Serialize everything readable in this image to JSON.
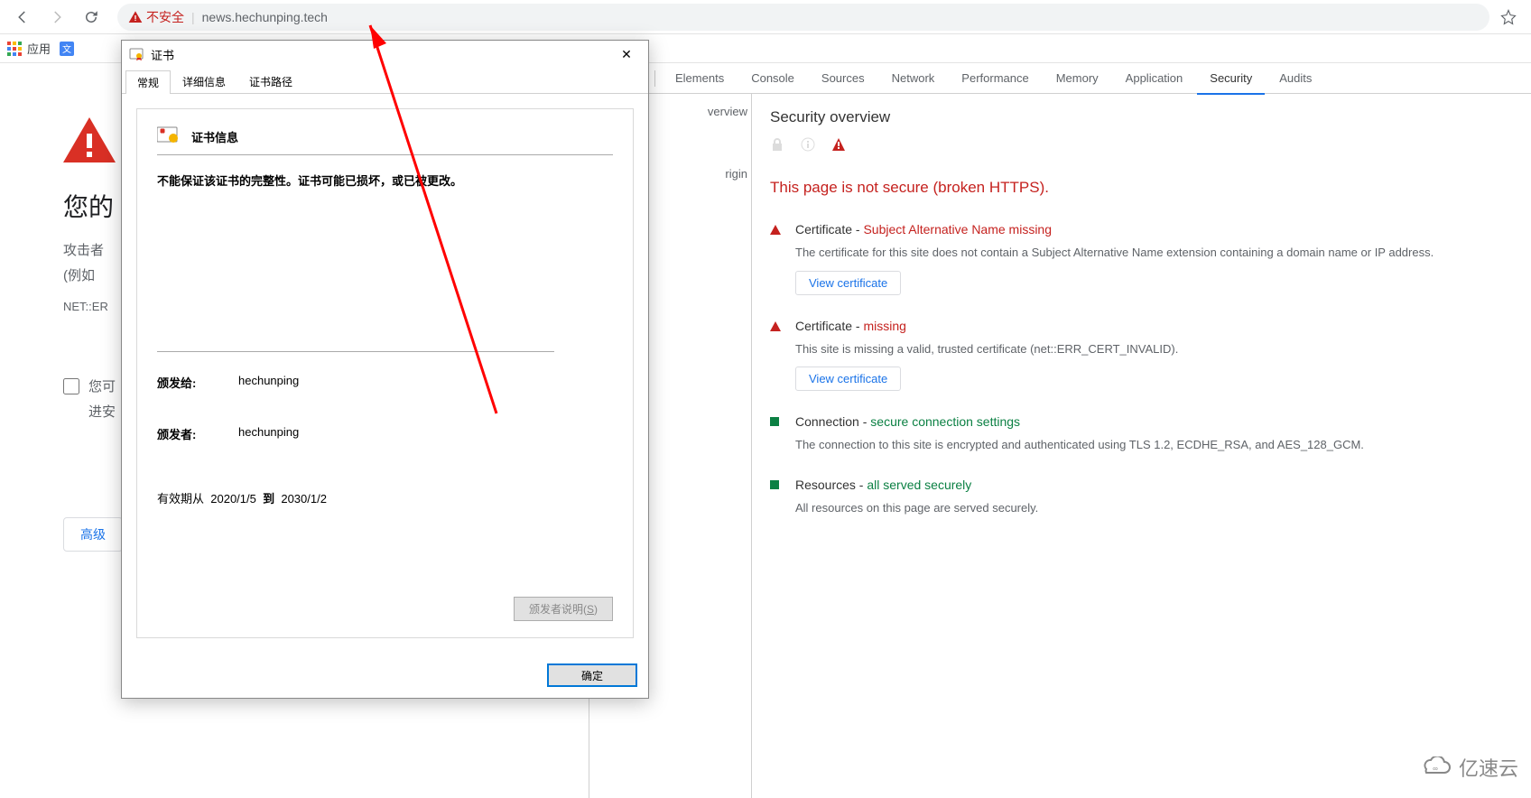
{
  "toolbar": {
    "not_secure": "不安全",
    "url": "news.hechunping.tech"
  },
  "bookmarks": {
    "apps_label": "应用"
  },
  "error_page": {
    "heading": "您的",
    "line1": "攻击者",
    "line2": "(例如",
    "code": "NET::ER",
    "report_line1": "您可",
    "report_line2": "进安",
    "advanced": "高级"
  },
  "cert": {
    "window_title": "证书",
    "tabs": {
      "general": "常规",
      "details": "详细信息",
      "path": "证书路径"
    },
    "info_header": "证书信息",
    "warn_line": "不能保证该证书的完整性。证书可能已损坏，或已被更改。",
    "issued_to_label": "颁发给:",
    "issued_to": "hechunping",
    "issued_by_label": "颁发者:",
    "issued_by": "hechunping",
    "valid_label": "有效期从",
    "valid_from": "2020/1/5",
    "valid_to_word": "到",
    "valid_to": "2030/1/2",
    "issuer_statement": "颁发者说明(",
    "issuer_statement_key": "S",
    "issuer_statement_end": ")",
    "ok": "确定"
  },
  "devtools": {
    "tabs": {
      "overview_cut": "verview",
      "origin_cut": "rigin",
      "elements": "Elements",
      "console": "Console",
      "sources": "Sources",
      "network": "Network",
      "performance": "Performance",
      "memory": "Memory",
      "application": "Application",
      "security": "Security",
      "audits": "Audits"
    },
    "sec_overview": "Security overview",
    "headline": "This page is not secure (broken HTTPS).",
    "items": [
      {
        "type": "red",
        "title_pre": "Certificate - ",
        "title_status": "Subject Alternative Name missing",
        "desc": "The certificate for this site does not contain a Subject Alternative Name extension containing a domain name or IP address.",
        "button": "View certificate"
      },
      {
        "type": "red",
        "title_pre": "Certificate - ",
        "title_status": "missing",
        "desc": "This site is missing a valid, trusted certificate (net::ERR_CERT_INVALID).",
        "button": "View certificate"
      },
      {
        "type": "green",
        "title_pre": "Connection - ",
        "title_status": "secure connection settings",
        "desc": "The connection to this site is encrypted and authenticated using TLS 1.2, ECDHE_RSA, and AES_128_GCM.",
        "button": ""
      },
      {
        "type": "green",
        "title_pre": "Resources - ",
        "title_status": "all served securely",
        "desc": "All resources on this page are served securely.",
        "button": ""
      }
    ]
  },
  "watermark": "亿速云"
}
